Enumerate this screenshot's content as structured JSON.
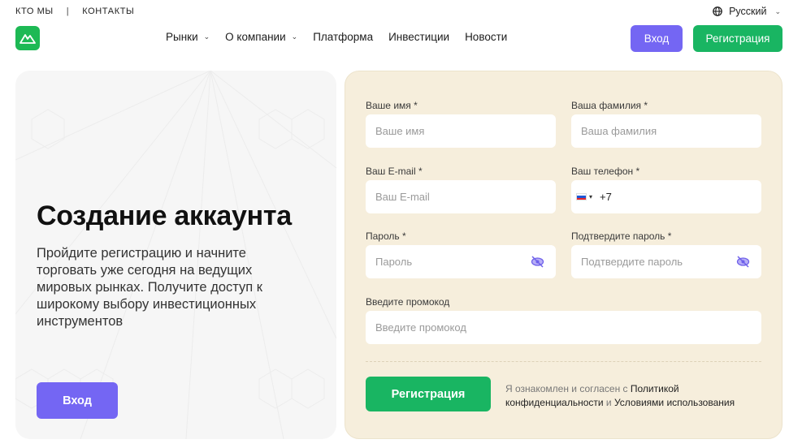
{
  "topbar": {
    "about": "КТО МЫ",
    "separator": "|",
    "contacts": "КОНТАКТЫ",
    "language": "Русский"
  },
  "icons": {
    "globe": "globe-icon",
    "chevron": "chevron-down-icon",
    "eye": "eye-off-icon",
    "logo": "mountain-logo-icon"
  },
  "nav": {
    "items": [
      {
        "label": "Рынки",
        "dropdown": true
      },
      {
        "label": "О компании",
        "dropdown": true
      },
      {
        "label": "Платформа",
        "dropdown": false
      },
      {
        "label": "Инвестиции",
        "dropdown": false
      },
      {
        "label": "Новости",
        "dropdown": false
      }
    ],
    "login_label": "Вход",
    "register_label": "Регистрация"
  },
  "hero": {
    "title": "Создание аккаунта",
    "text": "Пройдите регистрацию и начните торговать уже сегодня на ведущих мировых рынках. Получите доступ к широкому выбору инвестиционных инструментов",
    "login_label": "Вход"
  },
  "form": {
    "first_name": {
      "label": "Ваше имя *",
      "placeholder": "Ваше имя"
    },
    "last_name": {
      "label": "Ваша фамилия *",
      "placeholder": "Ваша фамилия"
    },
    "email": {
      "label": "Ваш E-mail *",
      "placeholder": "Ваш E-mail"
    },
    "phone": {
      "label": "Ваш телефон *",
      "code": "+7",
      "caret": "▾"
    },
    "password": {
      "label": "Пароль *",
      "placeholder": "Пароль"
    },
    "confirm_password": {
      "label": "Подтвердите пароль *",
      "placeholder": "Подтвердите пароль"
    },
    "promo": {
      "label": "Введите промокод",
      "placeholder": "Введите промокод"
    },
    "submit_label": "Регистрация",
    "agree_prefix": "Я ознакомлен и согласен с ",
    "agree_policy": "Политикой конфиденциальности",
    "agree_and": " и ",
    "agree_terms": "Условиями использования"
  },
  "colors": {
    "brand_green": "#19b562",
    "accent_purple": "#7466f3",
    "form_bg": "#f6eedc",
    "left_bg": "#f6f6f6"
  }
}
